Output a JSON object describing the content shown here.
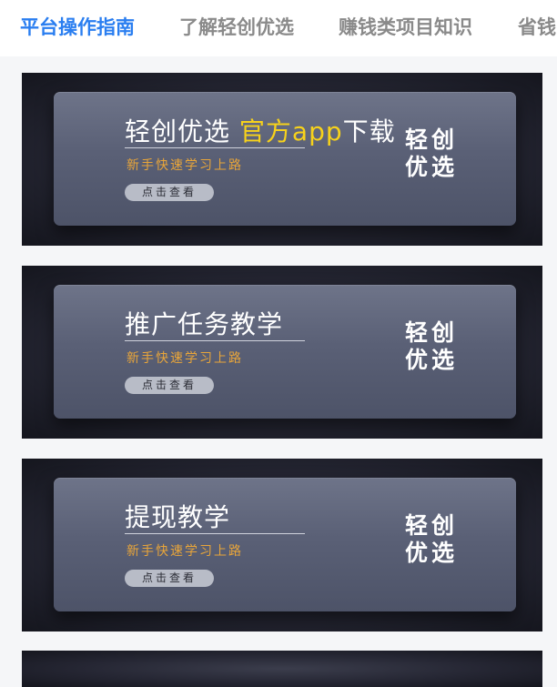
{
  "tabs": [
    {
      "label": "平台操作指南",
      "active": true
    },
    {
      "label": "了解轻创优选",
      "active": false
    },
    {
      "label": "赚钱类项目知识",
      "active": false
    },
    {
      "label": "省钱",
      "active": false
    }
  ],
  "banners": [
    {
      "title_main": "轻创优选 ",
      "title_highlight": "官方app",
      "title_tail": "下载",
      "subtitle": "新手快速学习上路",
      "cta": "点击查看",
      "logo_line1": "轻创",
      "logo_line2": "优选"
    },
    {
      "title_main": "推广任务教学",
      "subtitle": "新手快速学习上路",
      "cta": "点击查看",
      "logo_line1": "轻创",
      "logo_line2": "优选"
    },
    {
      "title_main": "提现教学",
      "subtitle": "新手快速学习上路",
      "cta": "点击查看",
      "logo_line1": "轻创",
      "logo_line2": "优选"
    }
  ],
  "colors": {
    "accent": "#2a7ef0",
    "tab_inactive": "#8a8a8a",
    "highlight": "#f7d21b",
    "subtitle": "#e8a53a"
  }
}
